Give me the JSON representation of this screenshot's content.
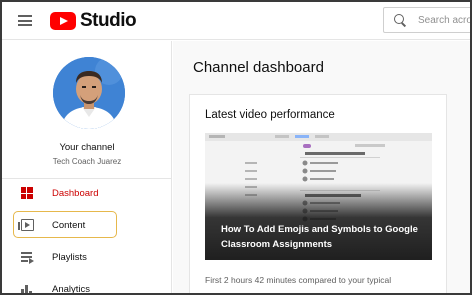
{
  "header": {
    "logo_text": "Studio",
    "search_placeholder": "Search across your channel"
  },
  "sidebar": {
    "your_channel_label": "Your channel",
    "channel_name": "Tech Coach Juarez",
    "items": [
      {
        "label": "Dashboard",
        "icon": "dashboard-icon",
        "active": true
      },
      {
        "label": "Content",
        "icon": "content-icon",
        "active": false
      },
      {
        "label": "Playlists",
        "icon": "playlists-icon",
        "active": false
      },
      {
        "label": "Analytics",
        "icon": "analytics-icon",
        "active": false
      }
    ]
  },
  "main": {
    "page_title": "Channel dashboard",
    "card": {
      "title": "Latest video performance",
      "video_title": "How To Add Emojis and Symbols to Google Classroom Assignments",
      "performance_text": "First 2 hours 42 minutes compared to your typical"
    }
  },
  "colors": {
    "brand_red": "#ff0000",
    "active_red": "#cc0000",
    "highlight": "#e6b84c"
  }
}
